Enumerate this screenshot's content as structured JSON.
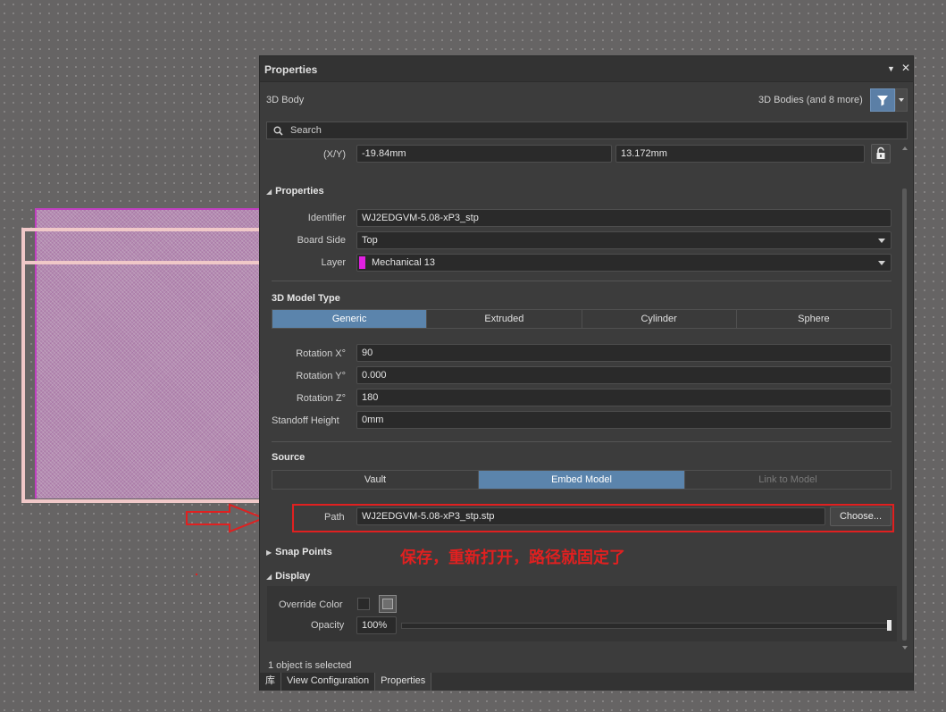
{
  "panel": {
    "title": "Properties",
    "object_type": "3D Body",
    "filter_summary": "3D Bodies (and 8 more)",
    "search_placeholder": "Search",
    "xy_label": "(X/Y)",
    "x_value": "-19.84mm",
    "y_value": "13.172mm"
  },
  "properties_section": {
    "header": "Properties",
    "identifier_label": "Identifier",
    "identifier_value": "WJ2EDGVM-5.08-xP3_stp",
    "board_side_label": "Board Side",
    "board_side_value": "Top",
    "layer_label": "Layer",
    "layer_value": "Mechanical 13",
    "layer_color": "#e020e0"
  },
  "model_type": {
    "header": "3D Model Type",
    "options": [
      "Generic",
      "Extruded",
      "Cylinder",
      "Sphere"
    ],
    "selected": "Generic",
    "rot_x_label": "Rotation X°",
    "rot_x_value": "90",
    "rot_y_label": "Rotation Y°",
    "rot_y_value": "0.000",
    "rot_z_label": "Rotation Z°",
    "rot_z_value": "180",
    "standoff_label": "Standoff Height",
    "standoff_value": "0mm"
  },
  "source": {
    "header": "Source",
    "options": [
      "Vault",
      "Embed Model",
      "Link to Model"
    ],
    "selected": "Embed Model",
    "path_label": "Path",
    "path_value": "WJ2EDGVM-5.08-xP3_stp.stp",
    "choose_label": "Choose..."
  },
  "snap_points": {
    "header": "Snap Points"
  },
  "display": {
    "header": "Display",
    "override_color_label": "Override Color",
    "opacity_label": "Opacity",
    "opacity_value": "100%",
    "opacity_fraction": 1.0
  },
  "status": {
    "text": "1 object is selected"
  },
  "bottom_tabs": [
    "库",
    "View Configuration",
    "Properties"
  ],
  "annotation": {
    "text": "保存，重新打开，路径就固定了",
    "color": "#e02020"
  }
}
